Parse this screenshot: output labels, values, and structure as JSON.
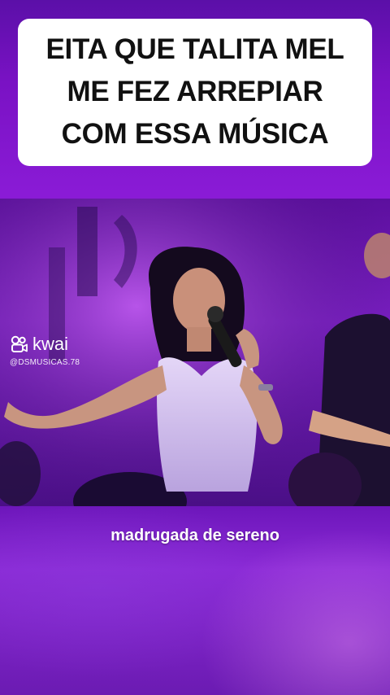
{
  "caption": {
    "lines": [
      "EITA QUE TALITA MEL",
      "ME FEZ ARREPIAR",
      "COM ESSA MÚSICA"
    ]
  },
  "watermark": {
    "brand": "kwai",
    "handle": "@DSMUSICAS.78"
  },
  "subtitle": "madrugada de sereno",
  "colors": {
    "background": "#7a12c4",
    "caption_bg": "#ffffff",
    "caption_text": "#111111",
    "subtitle_text": "#ffffff"
  },
  "icons": {
    "watermark": "kwai-logo-icon"
  }
}
